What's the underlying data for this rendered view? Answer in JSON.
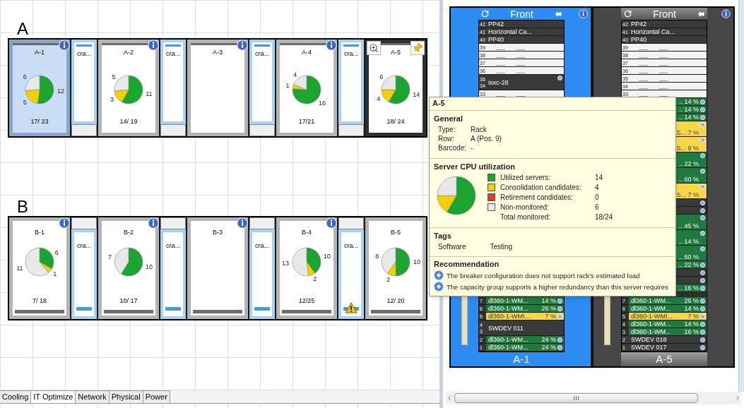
{
  "floor": {
    "rows": [
      {
        "label": "A",
        "flipped": false,
        "items": [
          {
            "kind": "rack",
            "name": "A-1",
            "selected": true,
            "highlighted": false,
            "info": true,
            "count": "17/ 23",
            "chart_data": {
              "type": "pie",
              "values": [
                12,
                5,
                0,
                6
              ],
              "data_labels": true
            }
          },
          {
            "kind": "cooling",
            "label": "cra...",
            "warning": false
          },
          {
            "kind": "rack",
            "name": "A-2",
            "selected": false,
            "highlighted": false,
            "info": true,
            "count": "14/ 19",
            "chart_data": {
              "type": "pie",
              "values": [
                11,
                3,
                0,
                5
              ],
              "data_labels": true
            }
          },
          {
            "kind": "cooling",
            "label": "cra...",
            "warning": false
          },
          {
            "kind": "rack",
            "name": "A-3",
            "selected": false,
            "highlighted": false,
            "info": true
          },
          {
            "kind": "cooling",
            "label": "cra...",
            "warning": false
          },
          {
            "kind": "rack",
            "name": "A-4",
            "selected": false,
            "highlighted": false,
            "info": true,
            "count": "17/21",
            "chart_data": {
              "type": "pie",
              "values": [
                16,
                1,
                0,
                4
              ],
              "data_labels": true
            }
          },
          {
            "kind": "cooling",
            "label": "cra...",
            "warning": false
          },
          {
            "kind": "rack",
            "name": "A-5",
            "selected": false,
            "highlighted": true,
            "info": false,
            "count": "18/ 24",
            "chart_data": {
              "type": "pie",
              "values": [
                14,
                4,
                0,
                6
              ],
              "data_labels": true
            }
          }
        ]
      },
      {
        "label": "B",
        "flipped": true,
        "items": [
          {
            "kind": "rack",
            "name": "B-1",
            "selected": false,
            "highlighted": false,
            "info": true,
            "count": "7/ 18",
            "chart_data": {
              "type": "pie",
              "values": [
                6,
                1,
                0,
                11
              ],
              "data_labels": true
            }
          },
          {
            "kind": "cooling",
            "label": "cra...",
            "warning": false
          },
          {
            "kind": "rack",
            "name": "B-2",
            "selected": false,
            "highlighted": false,
            "info": true,
            "count": "10/ 17",
            "chart_data": {
              "type": "pie",
              "values": [
                10,
                0,
                0,
                7
              ],
              "data_labels": true
            }
          },
          {
            "kind": "cooling",
            "label": "cra...",
            "warning": false
          },
          {
            "kind": "rack",
            "name": "B-3",
            "selected": false,
            "highlighted": false,
            "info": true
          },
          {
            "kind": "cooling",
            "label": "cra...",
            "warning": false
          },
          {
            "kind": "rack",
            "name": "B-4",
            "selected": false,
            "highlighted": false,
            "info": true,
            "count": "12/25",
            "chart_data": {
              "type": "pie",
              "values": [
                10,
                2,
                0,
                13
              ],
              "data_labels": true
            }
          },
          {
            "kind": "cooling",
            "label": "cra...",
            "warning": true
          },
          {
            "kind": "rack",
            "name": "B-5",
            "selected": false,
            "highlighted": false,
            "info": false,
            "count": "12/ 20",
            "chart_data": {
              "type": "pie",
              "values": [
                10,
                2,
                0,
                8
              ],
              "data_labels": true
            }
          }
        ]
      }
    ]
  },
  "view_tabs": [
    {
      "label": "Cooling",
      "selected": false
    },
    {
      "label": "IT Optimize",
      "selected": true
    },
    {
      "label": "Network",
      "selected": false
    },
    {
      "label": "Physical",
      "selected": false
    },
    {
      "label": "Power",
      "selected": false
    }
  ],
  "elevations": [
    {
      "title": "Front",
      "name": "A-1",
      "selected": true,
      "upper": [
        {
          "kind": "device",
          "numbers": [
            "42"
          ],
          "label": "PP42",
          "tall": false,
          "info": false
        },
        {
          "kind": "device",
          "numbers": [
            "41"
          ],
          "label": "Horizontal Ca...",
          "tall": false,
          "info": false
        },
        {
          "kind": "device",
          "numbers": [
            "40"
          ],
          "label": "PP40",
          "tall": false,
          "info": false
        },
        {
          "kind": "empty",
          "numbers": [
            "39"
          ],
          "tall": false,
          "info": false
        },
        {
          "kind": "empty",
          "numbers": [
            "38"
          ],
          "tall": false,
          "info": false
        },
        {
          "kind": "empty",
          "numbers": [
            "37"
          ],
          "tall": false,
          "info": false
        },
        {
          "kind": "empty",
          "numbers": [
            "36"
          ],
          "tall": false,
          "info": false
        },
        {
          "kind": "device",
          "numbers": [
            "35",
            "34"
          ],
          "label": "isxc-28",
          "tall": true,
          "info": true
        },
        {
          "kind": "empty",
          "numbers": [
            "33"
          ],
          "tall": false,
          "info": false
        }
      ],
      "lower": [
        {
          "kind": "server",
          "numbers": [
            "7"
          ],
          "label": "dl360-1-WM...",
          "reading": "14 %",
          "color": "#1f7a3d",
          "tall": false,
          "info": true
        },
        {
          "kind": "server",
          "numbers": [
            "6"
          ],
          "label": "dl360-1-WM...",
          "reading": "26 %",
          "color": "#1f7a3d",
          "tall": false,
          "info": true
        },
        {
          "kind": "server",
          "numbers": [
            "5"
          ],
          "label": "dl360-1-WMI...",
          "reading": "7 %",
          "color": "#f7d64c",
          "tall": false,
          "info": true
        },
        {
          "kind": "device",
          "numbers": [
            "4",
            "3"
          ],
          "label": "SWDEV 011",
          "tall": true,
          "info": false
        },
        {
          "kind": "server",
          "numbers": [
            "2"
          ],
          "label": "dl360-1-WM...",
          "reading": "24 %",
          "color": "#1f7a3d",
          "tall": false,
          "info": true
        },
        {
          "kind": "server",
          "numbers": [
            "1"
          ],
          "label": "dl360-1-WM...",
          "reading": "24 %",
          "color": "#1f7a3d",
          "tall": false,
          "info": true
        }
      ]
    },
    {
      "title": "Front",
      "name": "A-5",
      "selected": false,
      "upper": [
        {
          "kind": "device",
          "numbers": [
            "42"
          ],
          "label": "PP42",
          "tall": false,
          "info": false
        },
        {
          "kind": "device",
          "numbers": [
            "41"
          ],
          "label": "Horizontal Ca...",
          "tall": false,
          "info": false
        },
        {
          "kind": "device",
          "numbers": [
            "40"
          ],
          "label": "PP40",
          "tall": false,
          "info": false
        },
        {
          "kind": "empty",
          "numbers": [
            "39"
          ],
          "tall": false,
          "info": false
        },
        {
          "kind": "empty",
          "numbers": [
            "38"
          ],
          "tall": false,
          "info": false
        },
        {
          "kind": "empty",
          "numbers": [
            "37"
          ],
          "tall": false,
          "info": false
        },
        {
          "kind": "empty",
          "numbers": [
            "36"
          ],
          "tall": false,
          "info": false
        },
        {
          "kind": "empty",
          "numbers": [
            "35"
          ],
          "tall": false,
          "info": false
        },
        {
          "kind": "empty",
          "numbers": [
            "34"
          ],
          "tall": false,
          "info": false
        },
        {
          "kind": "empty",
          "numbers": [
            "33"
          ],
          "tall": false,
          "info": false
        },
        {
          "kind": "server",
          "reading": ".. 14 %",
          "color": "#1f7a3d",
          "tall": false,
          "info": true
        },
        {
          "kind": "server",
          "reading": ".. 14 %",
          "color": "#1f7a3d",
          "tall": false,
          "info": true
        },
        {
          "kind": "server",
          "reading": ".. 14 %",
          "color": "#1f7a3d",
          "tall": false,
          "info": true
        },
        {
          "kind": "server",
          "reading": "S... 7 %",
          "color": "#f7d64c",
          "tall": true,
          "info": true
        },
        {
          "kind": "server",
          "reading": "S... 9 %",
          "color": "#f7d64c",
          "tall": true,
          "info": true
        },
        {
          "kind": "server",
          "reading": ".. 22 %",
          "color": "#1f7a3d",
          "tall": true,
          "info": true
        },
        {
          "kind": "server",
          "reading": ".. 60 %",
          "color": "#1f7a3d",
          "tall": true,
          "info": true
        },
        {
          "kind": "server",
          "reading": "S... 7 %",
          "color": "#f7d64c",
          "tall": true,
          "info": true
        },
        {
          "kind": "device",
          "tall": false,
          "info": true
        },
        {
          "kind": "device",
          "tall": false,
          "info": true
        },
        {
          "kind": "server",
          "reading": ".. 45 %",
          "color": "#1f7a3d",
          "tall": true,
          "info": true
        },
        {
          "kind": "server",
          "reading": ".. 14 %",
          "color": "#1f7a3d",
          "tall": true,
          "info": true
        },
        {
          "kind": "server",
          "reading": ".. 60 %",
          "color": "#1f7a3d",
          "tall": true,
          "info": true
        },
        {
          "kind": "server",
          "reading": ".. 22 %",
          "color": "#1f7a3d",
          "tall": false,
          "info": true
        },
        {
          "kind": "device",
          "tall": false,
          "info": true
        },
        {
          "kind": "device",
          "tall": false,
          "info": true
        },
        {
          "kind": "server",
          "reading": ".. 16 %",
          "color": "#1f7a3d",
          "tall": false,
          "info": true
        }
      ],
      "lower": [
        {
          "kind": "server",
          "numbers": [
            "7"
          ],
          "label": "dl360-1-WM...",
          "reading": "26 %",
          "color": "#1f7a3d",
          "tall": false,
          "info": true
        },
        {
          "kind": "server",
          "numbers": [
            "6"
          ],
          "label": "dl360-1-WM...",
          "reading": "14 %",
          "color": "#1f7a3d",
          "tall": false,
          "info": true
        },
        {
          "kind": "server",
          "numbers": [
            "5"
          ],
          "label": "dl360-1-WMI...",
          "reading": "7 %",
          "color": "#f7d64c",
          "tall": false,
          "info": true
        },
        {
          "kind": "server",
          "numbers": [
            "4"
          ],
          "label": "dl360-1-WM...",
          "reading": "14 %",
          "color": "#1f7a3d",
          "tall": false,
          "info": true
        },
        {
          "kind": "server",
          "numbers": [
            "3"
          ],
          "label": "dl360-1-WM...",
          "reading": "16 %",
          "color": "#1f7a3d",
          "tall": false,
          "info": true
        },
        {
          "kind": "device",
          "numbers": [
            "2"
          ],
          "label": "SWDEV 018",
          "tall": false,
          "info": true
        },
        {
          "kind": "device",
          "numbers": [
            "1"
          ],
          "label": "SWDEV 017",
          "tall": false,
          "info": true
        }
      ]
    }
  ],
  "tooltip": {
    "title": "A-5",
    "general": {
      "heading": "General",
      "fields": [
        {
          "label": "Type:",
          "value": "Rack"
        },
        {
          "label": "Row:",
          "value": "A (Pos. 9)"
        },
        {
          "label": "Barcode:",
          "value": "-"
        }
      ]
    },
    "utilization": {
      "heading": "Server CPU utilization",
      "chart_data": {
        "type": "pie",
        "values": [
          58.3,
          16.7,
          0,
          25
        ]
      },
      "legend": [
        {
          "label": "Utilized servers:",
          "value": "14",
          "color": "#1aa531"
        },
        {
          "label": "Consolidation candidates:",
          "value": "4",
          "color": "#f5d000"
        },
        {
          "label": "Retirement candidates:",
          "value": "0",
          "color": "#e53935"
        },
        {
          "label": "Non-monitored:",
          "value": "6",
          "color": "#e8e8e8"
        }
      ],
      "total": {
        "label": "Total monitored:",
        "value": "18/24"
      }
    },
    "tags": {
      "heading": "Tags",
      "items": [
        "Software",
        "Testing"
      ]
    },
    "recommendation": {
      "heading": "Recommendation",
      "items": [
        "The breaker configuration does not support rack's estimated load",
        "The capacity group supports a higher redundancy than this server requires"
      ]
    }
  }
}
